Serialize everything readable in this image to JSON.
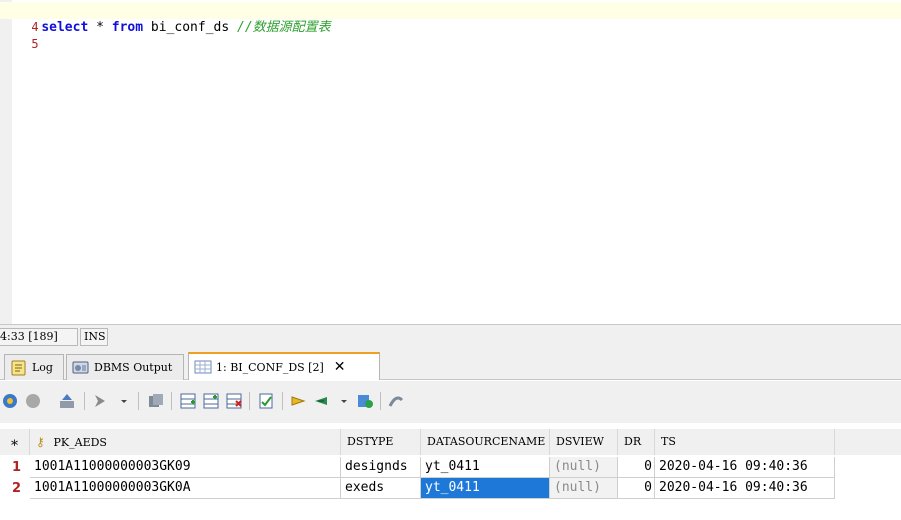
{
  "editor": {
    "lines": [
      {
        "number": "4",
        "keyword_select": "select",
        "star": "*",
        "keyword_from": "from",
        "table": "bi_conf_ds",
        "comment": "//数据源配置表"
      },
      {
        "number": "5"
      }
    ]
  },
  "statusbar": {
    "position": "4:33 [189]",
    "mode": "INS"
  },
  "tabs": [
    {
      "label": "Log",
      "icon": "log-icon"
    },
    {
      "label": "DBMS Output",
      "icon": "dbms-output-icon"
    },
    {
      "label": "1: BI_CONF_DS [2]",
      "icon": "grid-icon",
      "close": "✕"
    }
  ],
  "toolbar": {
    "icons": [
      "execute-icon",
      "stop-icon",
      "fetch-icon",
      "explain-icon",
      "dropdown-icon",
      "copy-icon",
      "insert-record-icon",
      "insert-record-after-icon",
      "delete-record-icon",
      "post-changes-icon",
      "commit-icon",
      "rollback-icon",
      "dropdown-icon",
      "refresh-icon",
      "clear-icon"
    ]
  },
  "grid": {
    "header_marker": "*",
    "columns": [
      "PK_AEDS",
      "DSTYPE",
      "DATASOURCENAME",
      "DSVIEW",
      "DR",
      "TS"
    ],
    "rows": [
      {
        "num": "1",
        "cells": [
          "1001A11000000003GK09",
          "designds",
          "yt_0411",
          "(null)",
          "0",
          "2020-04-16 09:40:36"
        ]
      },
      {
        "num": "2",
        "cells": [
          "1001A11000000003GK0A",
          "exeds",
          "yt_0411",
          "(null)",
          "0",
          "2020-04-16 09:40:36"
        ]
      }
    ],
    "colors": {
      "selection": "#1e78d8",
      "row_number": "#b22222"
    }
  }
}
